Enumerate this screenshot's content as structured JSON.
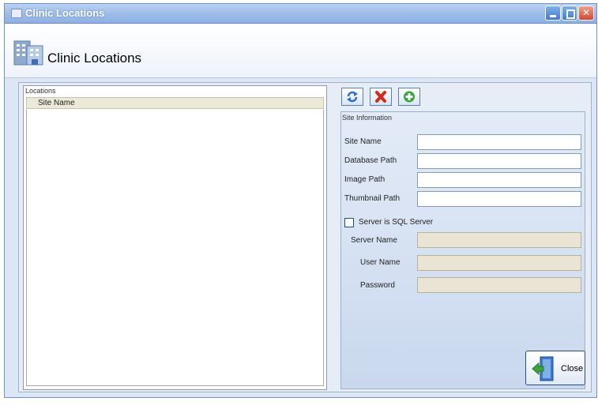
{
  "window": {
    "title": "Clinic Locations"
  },
  "header": {
    "title": "Clinic Locations"
  },
  "locations": {
    "group_label": "Locations",
    "column_header": "Site Name",
    "rows": []
  },
  "site_info": {
    "group_label": "Site Information",
    "fields": [
      {
        "label": "Site Name",
        "value": ""
      },
      {
        "label": "Database Path",
        "value": ""
      },
      {
        "label": "Image Path",
        "value": ""
      },
      {
        "label": "Thumbnail Path",
        "value": ""
      }
    ],
    "sql_checkbox_label": "Server is SQL Server",
    "sql_checked": false,
    "sql_fields": [
      {
        "label": "Server Name",
        "value": ""
      },
      {
        "label": "User Name",
        "value": ""
      },
      {
        "label": "Password",
        "value": ""
      }
    ]
  },
  "buttons": {
    "close_label": "Close"
  },
  "icons": [
    "app-icon",
    "building-icon",
    "refresh-icon",
    "delete-icon",
    "add-icon",
    "exit-door-icon",
    "minimize-icon",
    "maximize-icon",
    "close-window-icon"
  ],
  "colors": {
    "titlebar": "#9fbde9",
    "panel": "#dce6f4",
    "close_button_red": "#d9452b"
  }
}
